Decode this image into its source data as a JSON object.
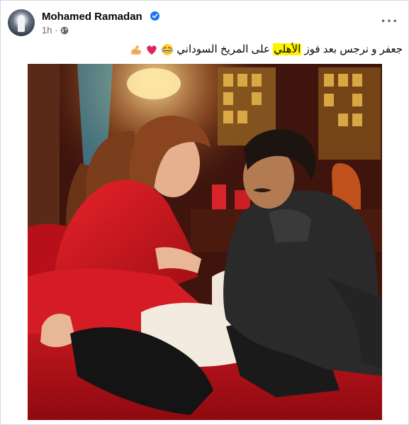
{
  "post": {
    "author": "Mohamed Ramadan",
    "timestamp": "1h",
    "privacy_icon": "globe-icon",
    "verified_icon": "verified-badge-icon",
    "menu_icon": "more-options-icon",
    "caption_before": "جعفر و نرجس بعد فوز ",
    "caption_highlight": "الأهلي",
    "caption_after": " على المريخ السوداني",
    "caption_emojis": [
      "laughing-face-icon",
      "red-heart-icon",
      "flexed-biceps-icon"
    ]
  },
  "colors": {
    "verified": "#1877f2",
    "text_primary": "#050505",
    "text_secondary": "#65676b",
    "highlight": "#fff200",
    "bed_red": "#c2111c"
  }
}
